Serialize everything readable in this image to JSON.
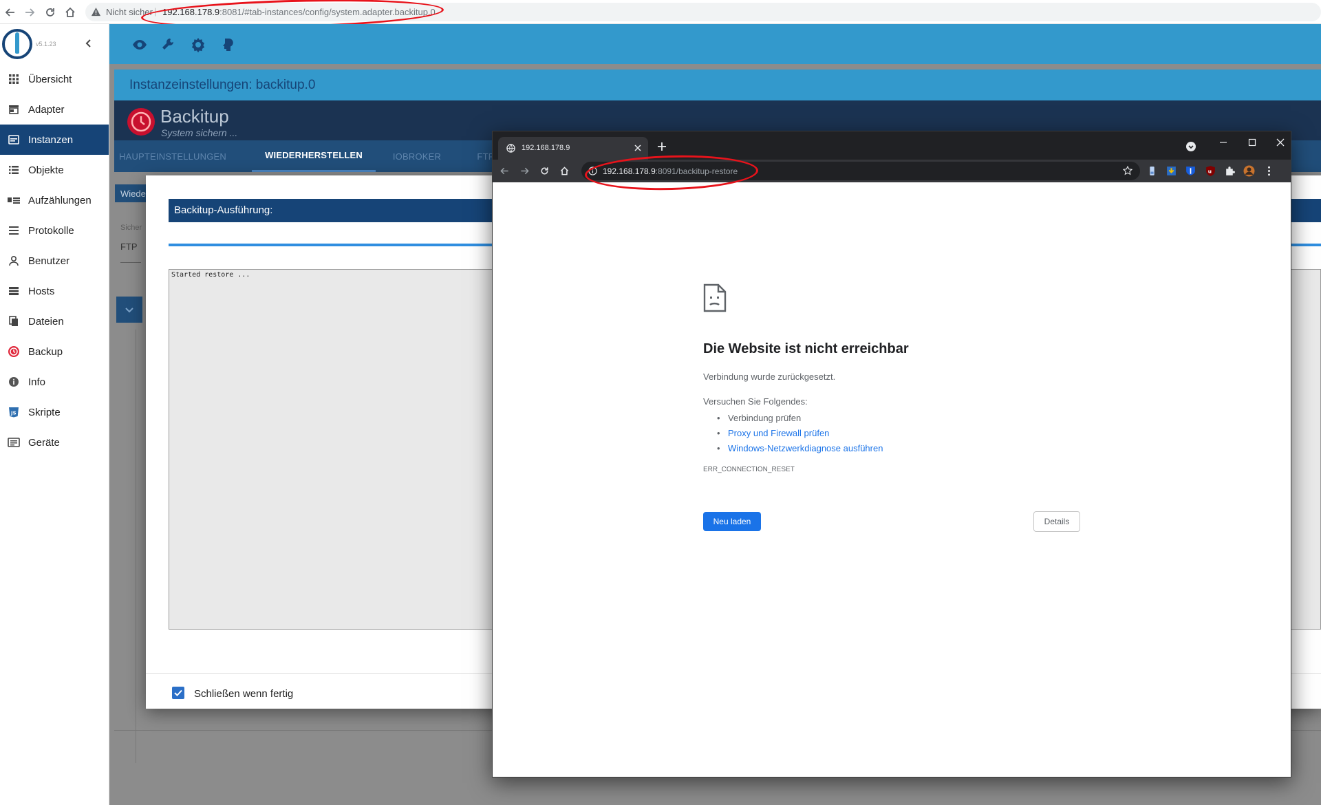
{
  "outer_browser": {
    "security_label": "Nicht sicher",
    "separator": "|",
    "url_host": "192.168.178.9",
    "url_rest": ":8081/#tab-instances/config/system.adapter.backitup.0"
  },
  "sidebar": {
    "version": "v5.1.23",
    "items": [
      {
        "label": "Übersicht",
        "icon": "grid-icon"
      },
      {
        "label": "Adapter",
        "icon": "store-icon"
      },
      {
        "label": "Instanzen",
        "icon": "instances-icon",
        "active": true
      },
      {
        "label": "Objekte",
        "icon": "list-icon"
      },
      {
        "label": "Aufzählungen",
        "icon": "enum-icon"
      },
      {
        "label": "Protokolle",
        "icon": "lines-icon"
      },
      {
        "label": "Benutzer",
        "icon": "user-icon"
      },
      {
        "label": "Hosts",
        "icon": "server-icon"
      },
      {
        "label": "Dateien",
        "icon": "files-icon"
      },
      {
        "label": "Backup",
        "icon": "backup-icon"
      },
      {
        "label": "Info",
        "icon": "info-icon"
      },
      {
        "label": "Skripte",
        "icon": "js-icon"
      },
      {
        "label": "Geräte",
        "icon": "devices-icon"
      }
    ]
  },
  "topbar": {
    "icons": [
      "eye-icon",
      "wrench-icon",
      "gear-icon",
      "expert-icon"
    ]
  },
  "instance_header": {
    "title": "Instanzeinstellungen: backitup.0"
  },
  "adapter": {
    "name": "Backitup",
    "subtitle": "System sichern ..."
  },
  "tabs": [
    {
      "label": "HAUPTEINSTELLUNGEN"
    },
    {
      "label": "WIEDERHERSTELLEN",
      "active": true
    },
    {
      "label": "IOBROKER"
    },
    {
      "label": "FTP"
    }
  ],
  "background_form": {
    "chip": "Wiede",
    "select_label": "Sicher",
    "select_value": "FTP"
  },
  "dialog": {
    "title": "Backitup-Ausführung:",
    "log_text": "Started restore ...",
    "close_when_done_label": "Schließen wenn fertig",
    "close_when_done_checked": true
  },
  "popup": {
    "tab_title": "192.168.178.9",
    "url_host": "192.168.178.9",
    "url_rest": ":8091/backitup-restore",
    "error": {
      "title": "Die Website ist nicht erreichbar",
      "subtitle": "Verbindung wurde zurückgesetzt.",
      "try_heading": "Versuchen Sie Folgendes:",
      "suggestions": [
        {
          "text": "Verbindung prüfen",
          "link": false
        },
        {
          "text": "Proxy und Firewall prüfen",
          "link": true
        },
        {
          "text": "Windows-Netzwerkdiagnose ausführen",
          "link": true
        }
      ],
      "code": "ERR_CONNECTION_RESET",
      "reload_label": "Neu laden",
      "details_label": "Details"
    }
  },
  "colors": {
    "accent_blue": "#3399cc",
    "dark_blue": "#164477",
    "annotation_red": "#e8131b",
    "chrome_link_blue": "#1a73e8"
  }
}
